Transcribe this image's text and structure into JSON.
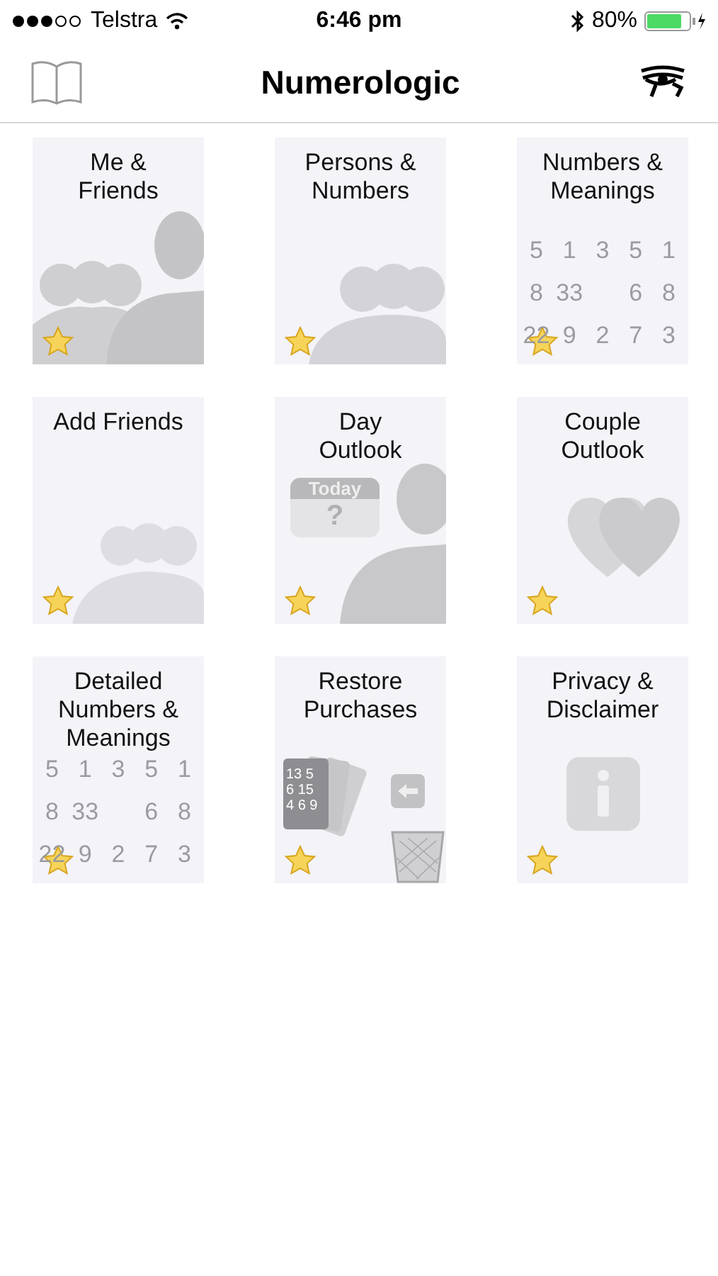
{
  "status_bar": {
    "carrier": "Telstra",
    "time": "6:46 pm",
    "battery": "80%"
  },
  "nav": {
    "title": "Numerologic"
  },
  "tiles": [
    {
      "title": "Me &\nFriends",
      "starred": true,
      "art": {
        "kind": "people"
      }
    },
    {
      "title": "Persons &\nNumbers",
      "starred": true,
      "art": {
        "kind": "group_faint"
      }
    },
    {
      "title": "Numbers &\nMeanings",
      "starred": true,
      "art": {
        "kind": "numbers",
        "rows": [
          [
            "5",
            "1",
            "3",
            "5",
            "1"
          ],
          [
            "8",
            "33",
            null,
            "6",
            "8"
          ],
          [
            "22",
            "9",
            "2",
            "7",
            "3"
          ]
        ]
      }
    },
    {
      "title": "Add Friends",
      "starred": true,
      "art": {
        "kind": "group"
      }
    },
    {
      "title": "Day\nOutlook",
      "starred": true,
      "art": {
        "kind": "calendar",
        "label": "Today",
        "mark": "?"
      }
    },
    {
      "title": "Couple\nOutlook",
      "starred": true,
      "art": {
        "kind": "hearts"
      }
    },
    {
      "title": "Detailed\nNumbers &\nMeanings",
      "starred": true,
      "art": {
        "kind": "numbers",
        "rows": [
          [
            "5",
            "1",
            "3",
            "5",
            "1"
          ],
          [
            "8",
            "33",
            null,
            "6",
            "8"
          ],
          [
            "22",
            "9",
            "2",
            "7",
            "3"
          ]
        ]
      }
    },
    {
      "title": "Restore\nPurchases",
      "starred": true,
      "art": {
        "kind": "restore",
        "lines": [
          "13 5",
          "6 15",
          "4 6 9"
        ]
      }
    },
    {
      "title": "Privacy &\nDisclaimer",
      "starred": true,
      "art": {
        "kind": "info"
      }
    }
  ]
}
